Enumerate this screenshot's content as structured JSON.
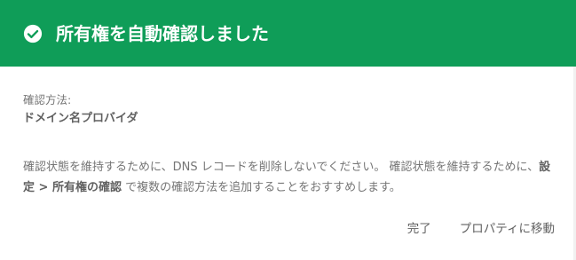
{
  "dialog": {
    "title": "所有権を自動確認しました",
    "method_label": "確認方法:",
    "method_value": "ドメイン名プロバイダ",
    "description_part1": "確認状態を維持するために、DNS レコードを削除しないでください。 確認状態を維持するために、",
    "description_link": "設定 > 所有権の確認",
    "description_part2": " で複数の確認方法を追加することをおすすめします。",
    "done_label": "完了",
    "go_to_property_label": "プロパティに移動"
  },
  "colors": {
    "header": "#0f9d58",
    "header_text": "#ffffff",
    "body_text": "#757575",
    "button_text": "#616161"
  },
  "icons": {
    "header_icon": "check-circle-icon"
  }
}
